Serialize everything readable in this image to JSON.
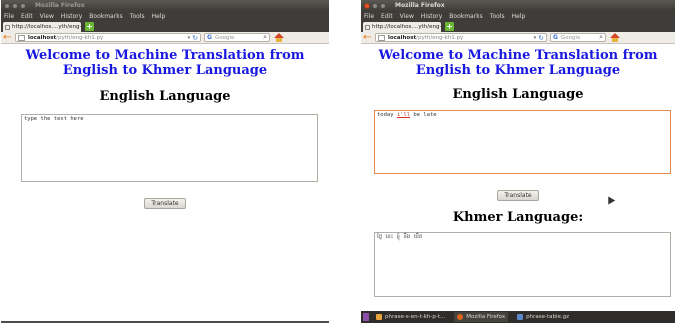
{
  "window": {
    "title": "Mozilla Firefox",
    "menu": [
      "File",
      "Edit",
      "View",
      "History",
      "Bookmarks",
      "Tools",
      "Help"
    ],
    "tab_label": "http://localhos....yth/eng-kh1.py",
    "url_host": "localhost",
    "url_path": "/pyth/eng-kh1.py",
    "search_placeholder": "Google"
  },
  "page": {
    "welcome_line1": "Welcome to Machine Translation from",
    "welcome_line2": "English to Khmer Language",
    "english_heading": "English Language",
    "khmer_heading": "Khmer Language:",
    "translate_label": "Translate"
  },
  "left": {
    "textarea_placeholder": "type the text here"
  },
  "right": {
    "input_before": "today ",
    "input_misspelled": "i'll",
    "input_after": " be late",
    "output_text": "ថ្ងៃ នេះ ខ្ញុំ នឹង យឺត"
  },
  "taskbar": {
    "items": [
      "phrase-s-en-t-kh-p-t...",
      "Mozilla Firefox",
      "phrase-table.gz"
    ]
  },
  "colors": {
    "welcome": "#1818e0",
    "titlebar": "#3e3d39",
    "focus_border": "#e08a54",
    "back_arrow": "#e77a1a"
  }
}
